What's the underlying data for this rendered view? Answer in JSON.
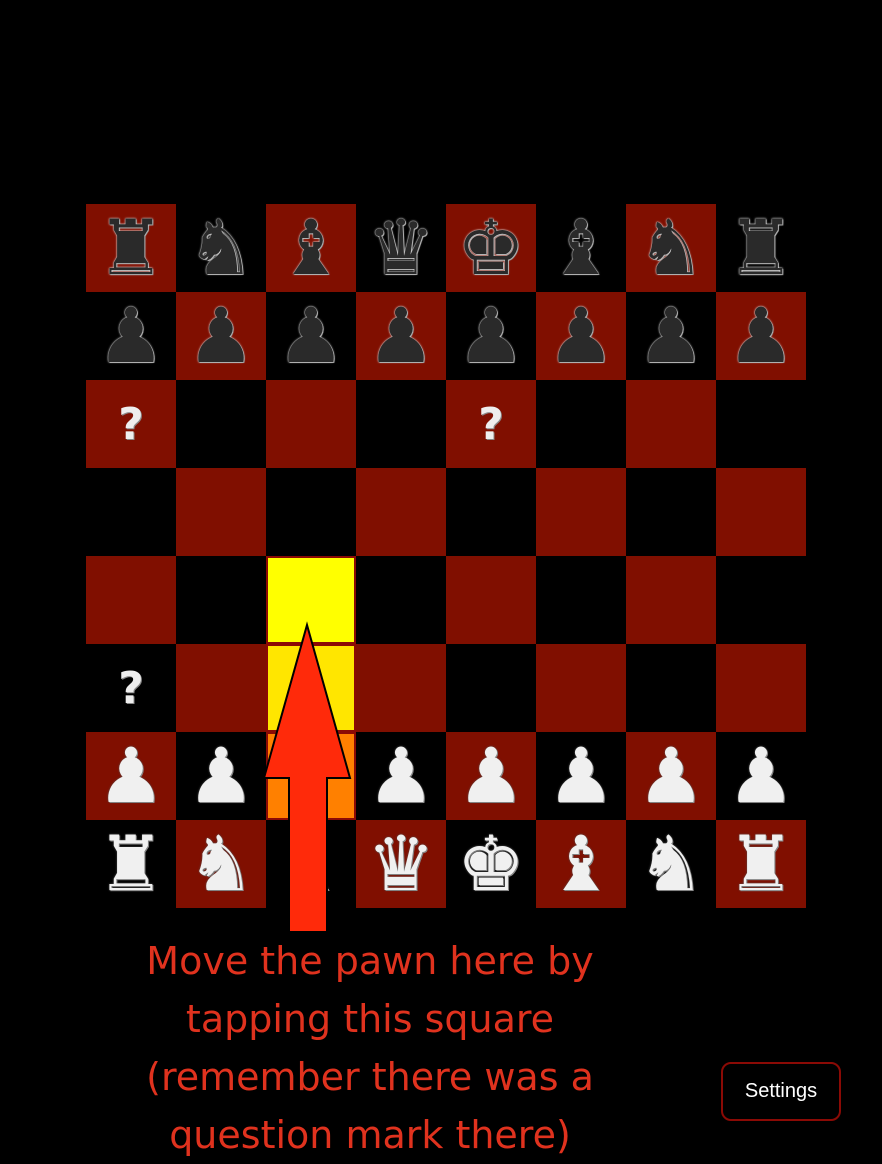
{
  "colors": {
    "dark_square": "#800f00",
    "light_square": "#000000",
    "highlight_target": "#ffff00",
    "highlight_path": "#ffe600",
    "highlight_source": "#ff8000",
    "arrow": "#ff2a0a",
    "hint_text": "#e0321e"
  },
  "board": {
    "ranks": [
      [
        "bR",
        "bN",
        "bB",
        "bQ",
        "bK",
        "bB",
        "bN",
        "bR"
      ],
      [
        "bP",
        "bP",
        "bP",
        "bP",
        "bP",
        "bP",
        "bP",
        "bP"
      ],
      [
        "?",
        "",
        "",
        "",
        "?",
        "",
        "",
        ""
      ],
      [
        "",
        "",
        "",
        "",
        "",
        "",
        "",
        ""
      ],
      [
        "",
        "",
        "",
        "",
        "",
        "",
        "",
        ""
      ],
      [
        "?",
        "",
        "",
        "",
        "",
        "",
        "",
        ""
      ],
      [
        "wP",
        "wP",
        "",
        "wP",
        "wP",
        "wP",
        "wP",
        "wP"
      ],
      [
        "wR",
        "wN",
        "wB",
        "wQ",
        "wK",
        "wB",
        "wN",
        "wR"
      ]
    ],
    "highlights": [
      {
        "row": 4,
        "col": 2,
        "kind": "target"
      },
      {
        "row": 5,
        "col": 2,
        "kind": "path"
      },
      {
        "row": 6,
        "col": 2,
        "kind": "source"
      }
    ],
    "question_mark": "?"
  },
  "hint": {
    "text": "Move the pawn here by\ntapping this square\n(remember there was a\nquestion mark there)"
  },
  "settings_button": {
    "label": "Settings"
  }
}
